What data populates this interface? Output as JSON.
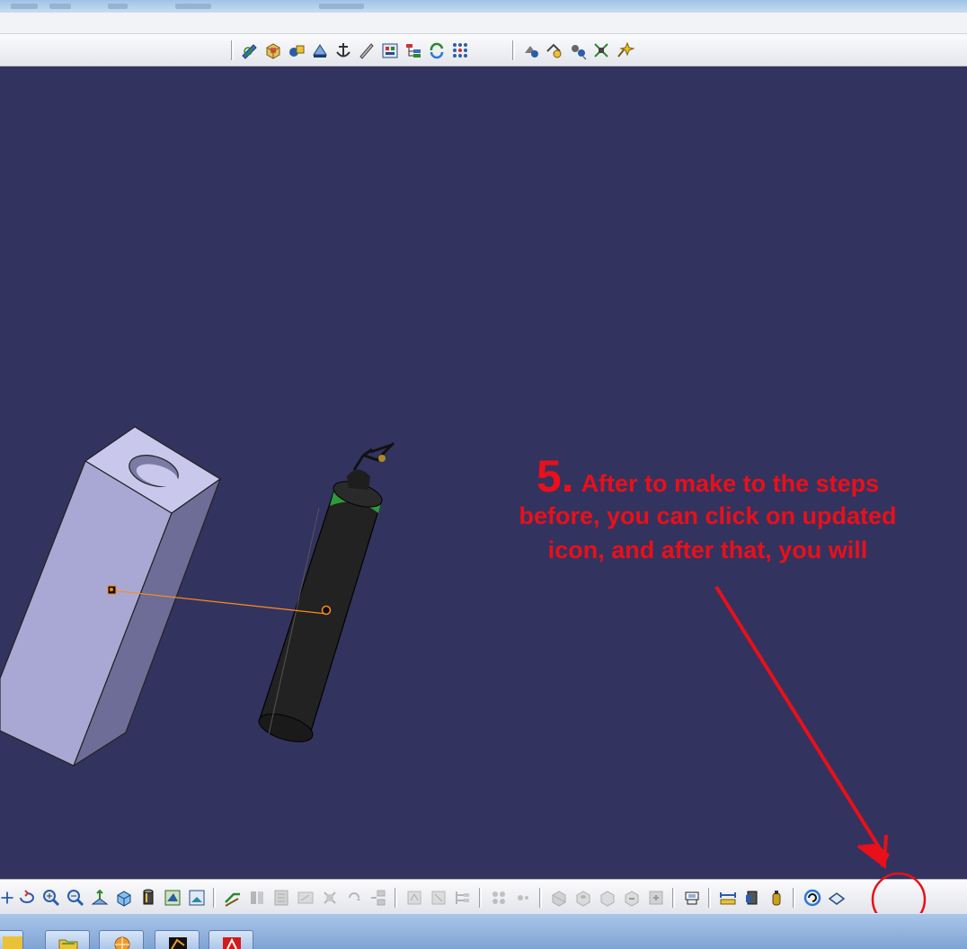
{
  "annotation": {
    "step_number": "5.",
    "line1": "After to make to the steps",
    "line2": "before, you can click on updated",
    "line3": "icon, and after that, you will",
    "color": "#e8101a"
  },
  "colors": {
    "viewport_background": "#33335f",
    "block_face_light": "#c9c8ec",
    "block_face_mid": "#a9a8d4",
    "block_face_dark": "#6e6d98",
    "cylinder_body": "#222222",
    "cylinder_band": "#2e9a3a",
    "constraint_line": "#ff8c1a",
    "highlight_circle": "#e8101a"
  },
  "top_toolbar": {
    "group1": [
      "sketch-icon",
      "part-body-icon",
      "shaded-part-icon",
      "pad-icon",
      "anchor-icon",
      "pencil-icon",
      "catalog-icon",
      "tree-icon",
      "refresh-cycle-icon",
      "grid-icon"
    ],
    "group2": [
      "manipulate-icon",
      "snap-icon",
      "explode-icon",
      "fix-constraint-icon",
      "smart-move-icon"
    ]
  },
  "bottom_toolbar": {
    "view_tools": [
      "pan-icon",
      "rotate-icon",
      "zoom-in-icon",
      "zoom-out-icon",
      "normal-view-icon",
      "iso-view-icon",
      "cylinder-view-icon",
      "render-style-icon",
      "hide-show-icon"
    ],
    "constraint_tools": [
      "coincidence-icon",
      "contact-icon",
      "offset-icon",
      "angle-icon",
      "fix-icon",
      "fix-together-icon",
      "quick-constraint-icon"
    ],
    "disabled_tools": [
      "flexible-icon",
      "change-constraint-icon",
      "reuse-pattern-icon",
      "multi-instantiation-icon",
      "fast-multi-icon",
      "split-icon",
      "hole-icon",
      "groove-icon",
      "remove-icon",
      "add-icon",
      "symmetry-icon"
    ],
    "analysis_tools": [
      "measure-between-icon",
      "measure-item-icon",
      "measure-inertia-icon",
      "update-icon",
      "layer-icon"
    ]
  },
  "taskbar": {
    "buttons": [
      "explorer-icon",
      "folder-icon",
      "browser-icon",
      "catia-icon",
      "pdf-icon"
    ]
  }
}
